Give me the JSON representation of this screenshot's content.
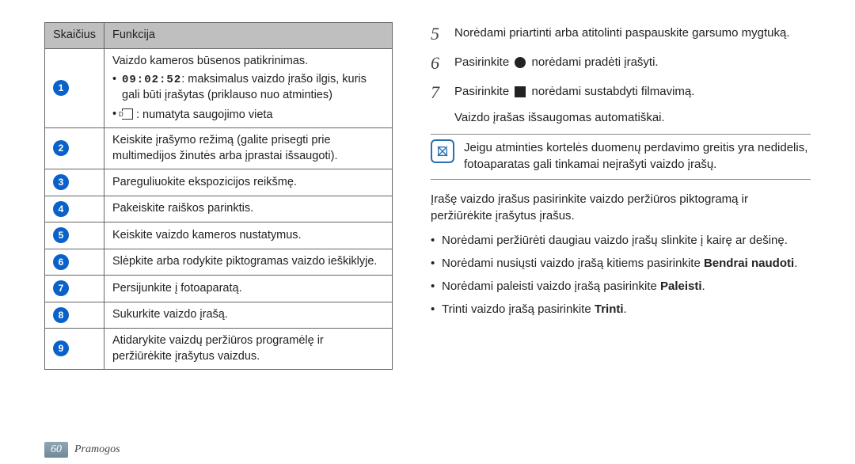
{
  "table": {
    "header_num": "Skaičius",
    "header_func": "Funkcija",
    "row1": {
      "lead": "Vaizdo kameros būsenos patikrinimas.",
      "time": "09:02:52",
      "time_desc": ": maksimalus vaizdo įrašo ilgis, kuris gali būti įrašytas (priklauso nuo atminties)",
      "storage": ": numatyta saugojimo vieta"
    },
    "row2": "Keiskite įrašymo režimą (galite prisegti prie multimedijos žinutės arba įprastai išsaugoti).",
    "row3": "Pareguliuokite ekspozicijos reikšmę.",
    "row4": "Pakeiskite raiškos parinktis.",
    "row5": "Keiskite vaizdo kameros nustatymus.",
    "row6": "Slėpkite arba rodykite piktogramas vaizdo ieškiklyje.",
    "row7": "Persijunkite į fotoaparatą.",
    "row8": "Sukurkite vaizdo įrašą.",
    "row9": "Atidarykite vaizdų peržiūros programėlę ir peržiūrėkite įrašytus vaizdus."
  },
  "steps": {
    "s5": "Norėdami priartinti arba atitolinti paspauskite garsumo mygtuką.",
    "s6_a": "Pasirinkite ",
    "s6_b": " norėdami pradėti įrašyti.",
    "s7_a": "Pasirinkite ",
    "s7_b": " norėdami sustabdyti filmavimą.",
    "auto": "Vaizdo įrašas išsaugomas automatiškai."
  },
  "note": "Jeigu atminties kortelės duomenų perdavimo greitis yra nedidelis, fotoaparatas gali tinkamai neįrašyti vaizdo įrašų.",
  "after_note": "Įrašę vaizdo įrašus pasirinkite vaizdo peržiūros piktogramą ir peržiūrėkite įrašytus įrašus.",
  "bullets": {
    "b1": "Norėdami peržiūrėti daugiau vaizdo įrašų slinkite į kairę ar dešinę.",
    "b2_a": "Norėdami nusiųsti vaizdo įrašą kitiems pasirinkite ",
    "b2_b": "Bendrai naudoti",
    "b3_a": "Norėdami paleisti vaizdo įrašą pasirinkite ",
    "b3_b": "Paleisti",
    "b4_a": "Trinti vaizdo įrašą pasirinkite ",
    "b4_b": "Trinti"
  },
  "footer": {
    "page": "60",
    "section": "Pramogos"
  }
}
